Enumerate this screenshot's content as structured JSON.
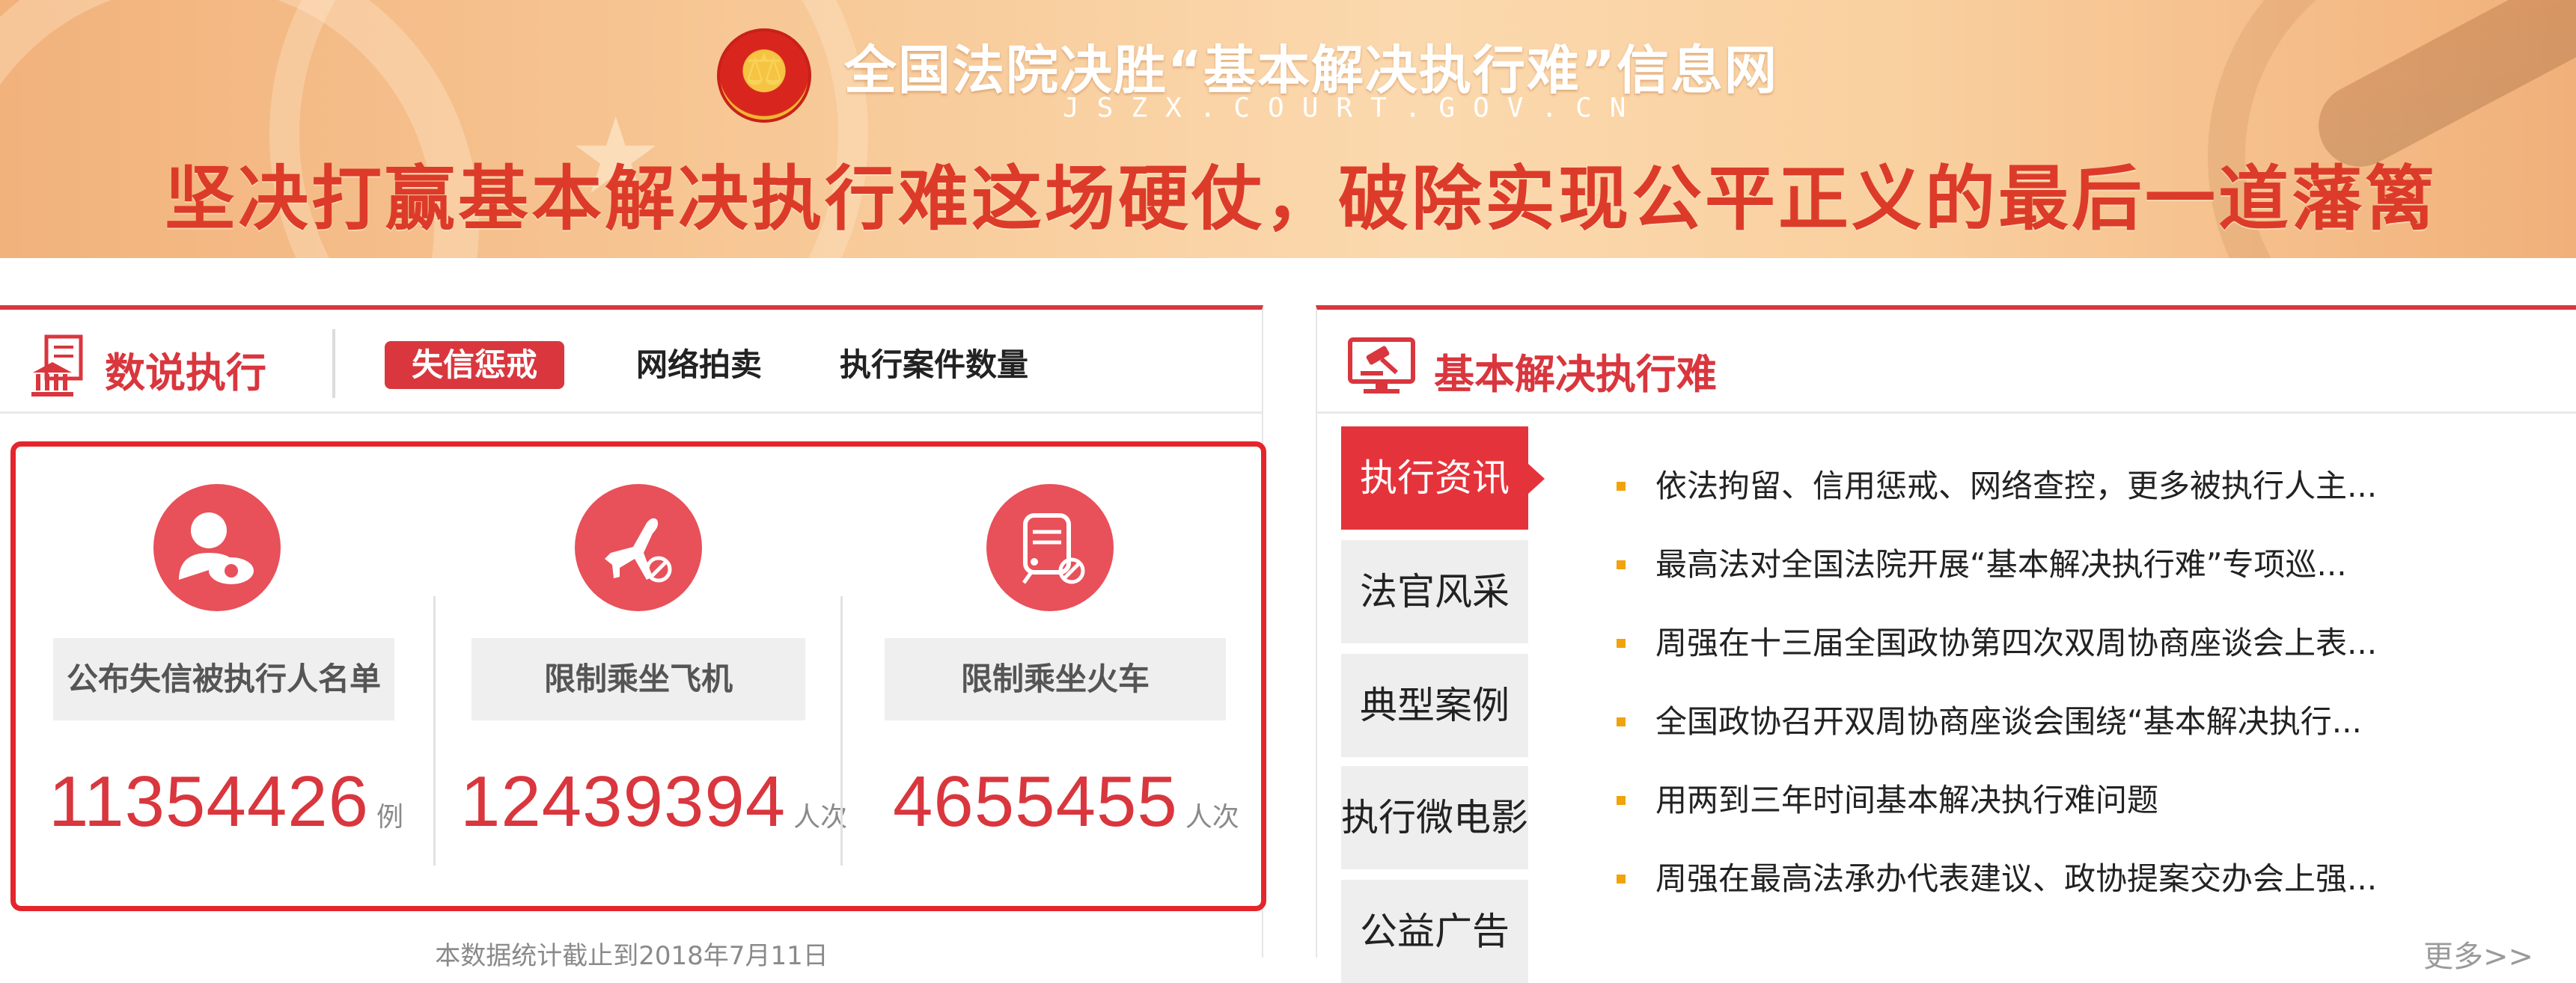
{
  "banner": {
    "site_title": "全国法院决胜“基本解决执行难”信息网",
    "domain": "JSZX.COURT.GOV.CN",
    "slogan": "坚决打赢基本解决执行难这场硬仗，破除实现公平正义的最后一道藩篱",
    "emblem_icon": "court-emblem-icon"
  },
  "data_panel": {
    "title": "数说执行",
    "icon": "courthouse-document-icon",
    "tabs": [
      {
        "label": "失信惩戒",
        "active": true
      },
      {
        "label": "网络拍卖",
        "active": false
      },
      {
        "label": "执行案件数量",
        "active": false
      }
    ],
    "stats": [
      {
        "label": "公布失信被执行人名单",
        "value": "11354426",
        "unit": "例",
        "icon": "person-eye-icon"
      },
      {
        "label": "限制乘坐飞机",
        "value": "12439394",
        "unit": "人次",
        "icon": "airplane-banned-icon"
      },
      {
        "label": "限制乘坐火车",
        "value": "4655455",
        "unit": "人次",
        "icon": "train-banned-icon"
      }
    ],
    "footnote": "本数据统计截止到2018年7月11日",
    "accent_color": "#d9363e"
  },
  "news_panel": {
    "title": "基本解决执行难",
    "icon": "gavel-monitor-icon",
    "side_tabs": [
      {
        "label": "执行资讯",
        "active": true
      },
      {
        "label": "法官风采",
        "active": false
      },
      {
        "label": "典型案例",
        "active": false
      },
      {
        "label": "执行微电影",
        "active": false
      },
      {
        "label": "公益广告",
        "active": false
      }
    ],
    "items": [
      "依法拘留、信用惩戒、网络查控，更多被执行人主...",
      "最高法对全国法院开展“基本解决执行难”专项巡...",
      "周强在十三届全国政协第四次双周协商座谈会上表...",
      "全国政协召开双周协商座谈会围绕“基本解决执行...",
      "用两到三年时间基本解决执行难问题",
      "周强在最高法承办代表建议、政协提案交办会上强..."
    ],
    "more": "更多>>",
    "bullet_color": "#f0a30a"
  }
}
